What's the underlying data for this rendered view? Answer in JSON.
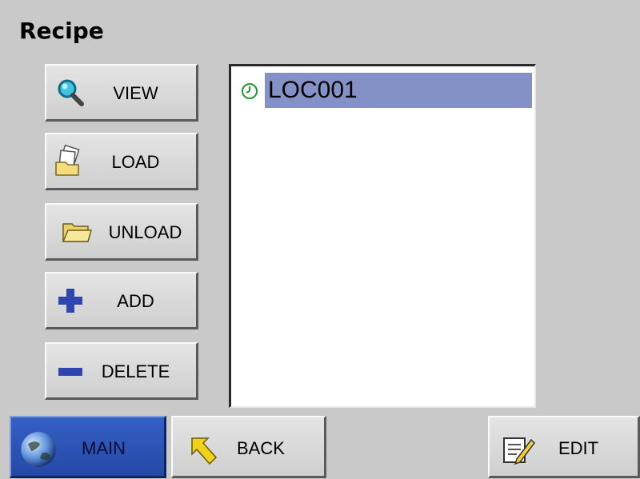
{
  "header": {
    "title": "Recipe"
  },
  "sidebar": {
    "buttons": [
      {
        "label": "VIEW",
        "icon": "magnifier-icon"
      },
      {
        "label": "LOAD",
        "icon": "documents-folder-icon"
      },
      {
        "label": "UNLOAD",
        "icon": "open-folder-icon"
      },
      {
        "label": "ADD",
        "icon": "plus-icon"
      },
      {
        "label": "DELETE",
        "icon": "minus-icon"
      }
    ]
  },
  "recipe_list": {
    "items": [
      {
        "label": "LOC001",
        "icon": "clock-icon",
        "selected": true
      }
    ]
  },
  "footer": {
    "main_label": "MAIN",
    "back_label": "BACK",
    "edit_label": "EDIT"
  },
  "colors": {
    "background": "#c9c9c9",
    "selection": "#8391c6",
    "main_button": "#2f56b8"
  }
}
